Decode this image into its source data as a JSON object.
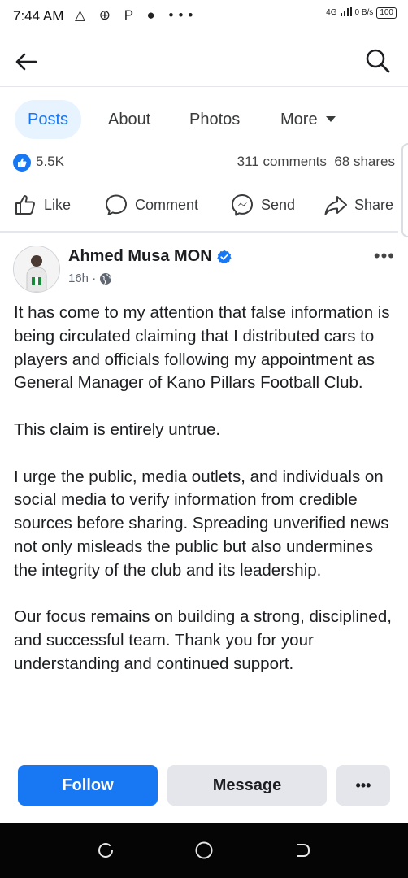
{
  "status": {
    "time": "7:44 AM",
    "indicators": "△ ⊕ P ● •••",
    "network": "4G",
    "speed": "0 B/s",
    "battery": "100"
  },
  "tabs": [
    {
      "label": "Posts",
      "active": true
    },
    {
      "label": "About",
      "active": false
    },
    {
      "label": "Photos",
      "active": false
    },
    {
      "label": "More",
      "active": false
    }
  ],
  "reactions": {
    "count": "5.5K",
    "comments_shares": "311 comments  68 shares"
  },
  "actions": {
    "like": "Like",
    "comment": "Comment",
    "send": "Send",
    "share": "Share"
  },
  "post": {
    "author": "Ahmed Musa MON",
    "time": "16h ·",
    "paragraphs": [
      "It has come to my attention that false information is being circulated claiming that I distributed cars to players and officials following my appointment as General Manager of Kano Pillars Football Club.",
      "This claim is entirely untrue.",
      "I urge the public, media outlets, and individuals on social media to verify information from credible sources before sharing. Spreading unverified news not only misleads the public but also undermines the integrity of the club and its leadership.",
      "Our focus remains on building a strong, disciplined, and successful team. Thank you for your understanding and continued support."
    ]
  },
  "buttons": {
    "follow": "Follow",
    "message": "Message",
    "overflow": "•••"
  },
  "colors": {
    "accent": "#1877f2",
    "tab_active_bg": "#e7f3ff",
    "button_gray": "#e4e6eb",
    "nav_bar": "#050505"
  },
  "icons": [
    "back-arrow-icon",
    "search-icon",
    "chevron-down-icon",
    "like-badge-icon",
    "thumbs-up-icon",
    "comment-bubble-icon",
    "messenger-icon",
    "share-arrow-icon",
    "verified-badge-icon",
    "globe-icon",
    "more-dots-icon"
  ]
}
